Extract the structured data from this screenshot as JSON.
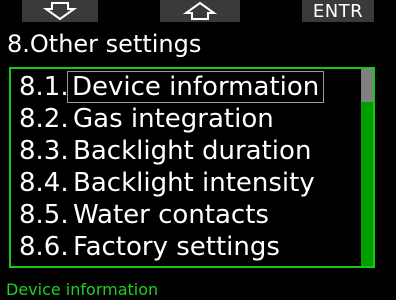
{
  "softkeys": {
    "left_icon": "arrow-down-icon",
    "middle_icon": "arrow-up-icon",
    "right_label": "ENTR"
  },
  "title": "8.Other settings",
  "menu": {
    "items": [
      {
        "num": "8.1.",
        "label": "Device information",
        "selected": true
      },
      {
        "num": "8.2.",
        "label": "Gas integration",
        "selected": false
      },
      {
        "num": "8.3.",
        "label": "Backlight duration",
        "selected": false
      },
      {
        "num": "8.4.",
        "label": "Backlight intensity",
        "selected": false
      },
      {
        "num": "8.5.",
        "label": "Water contacts",
        "selected": false
      },
      {
        "num": "8.6.",
        "label": "Factory settings",
        "selected": false
      }
    ]
  },
  "status_text": "Device information",
  "colors": {
    "accent_green": "#18c818",
    "status_green": "#1fd01f",
    "softkey_bg": "#3a3a3a",
    "background": "#000000"
  }
}
